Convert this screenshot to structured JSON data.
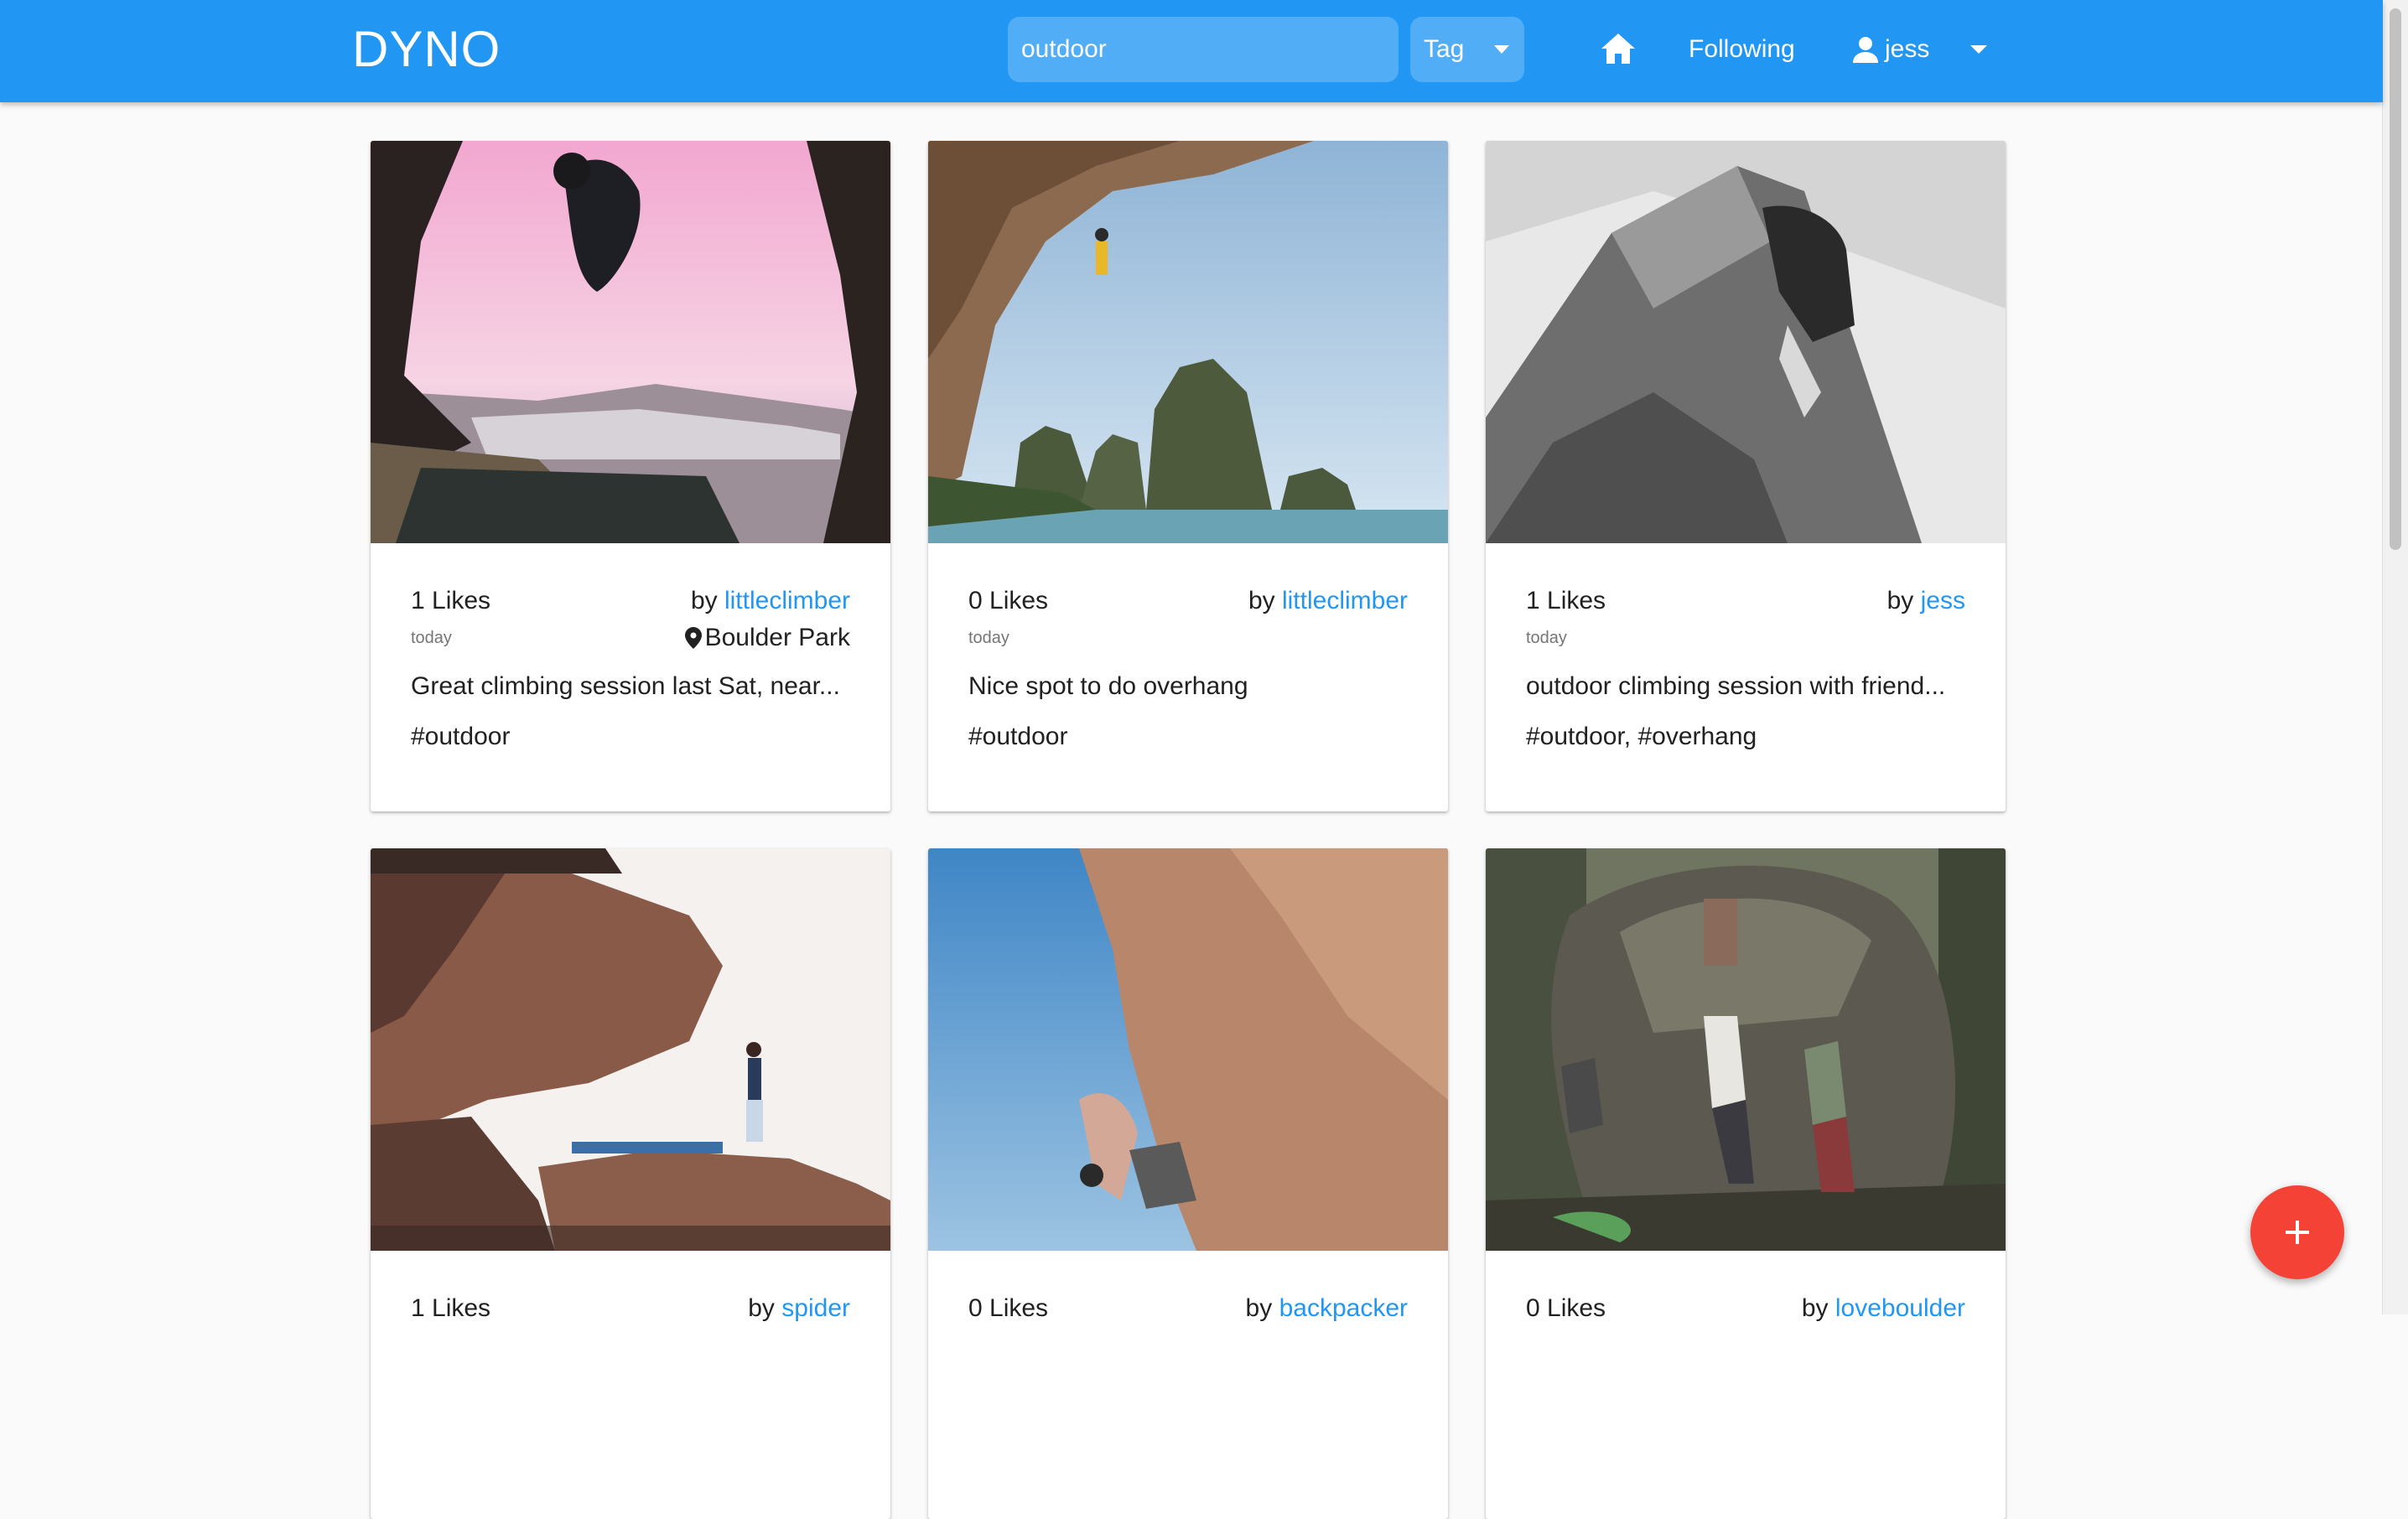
{
  "appbar": {
    "brand": "DYNO",
    "search_value": "outdoor",
    "search_placeholder": "Search",
    "filter_selected": "Tag",
    "nav_following": "Following",
    "user_name": "jess",
    "bar_color": "#2196f3"
  },
  "posts": [
    {
      "likes": "1 Likes",
      "by_prefix": "by",
      "author": "littleclimber",
      "date": "today",
      "location": "Boulder Park",
      "caption": "Great climbing session last Sat, near...",
      "tags": "#outdoor"
    },
    {
      "likes": "0 Likes",
      "by_prefix": "by",
      "author": "littleclimber",
      "date": "today",
      "location": "",
      "caption": "Nice spot to do overhang",
      "tags": "#outdoor"
    },
    {
      "likes": "1 Likes",
      "by_prefix": "by",
      "author": "jess",
      "date": "today",
      "location": "",
      "caption": "outdoor climbing session with friend...",
      "tags": "#outdoor, #overhang"
    },
    {
      "likes": "1 Likes",
      "by_prefix": "by",
      "author": "spider",
      "date": "",
      "location": "",
      "caption": "",
      "tags": ""
    },
    {
      "likes": "0 Likes",
      "by_prefix": "by",
      "author": "backpacker",
      "date": "",
      "location": "",
      "caption": "",
      "tags": ""
    },
    {
      "likes": "0 Likes",
      "by_prefix": "by",
      "author": "loveboulder",
      "date": "",
      "location": "",
      "caption": "",
      "tags": ""
    }
  ],
  "icons": {
    "home": "home-icon",
    "user": "account-icon",
    "location": "map-marker-icon",
    "add": "plus-icon"
  },
  "colors": {
    "accent": "#2196f3",
    "fab": "#f44336",
    "link": "#2196f3"
  }
}
